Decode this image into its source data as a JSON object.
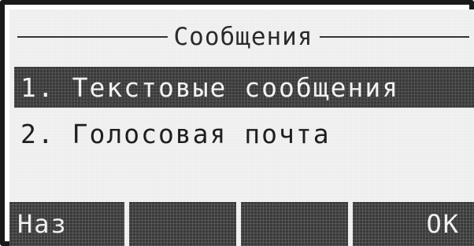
{
  "screen": {
    "title": "Сообщения"
  },
  "menu": {
    "items": [
      {
        "label": "1. Текстовые сообщения",
        "selected": true
      },
      {
        "label": "2. Голосовая почта",
        "selected": false
      }
    ]
  },
  "softkeys": {
    "left": "Наз",
    "center_left": "",
    "center_right": "",
    "right": "OK"
  }
}
